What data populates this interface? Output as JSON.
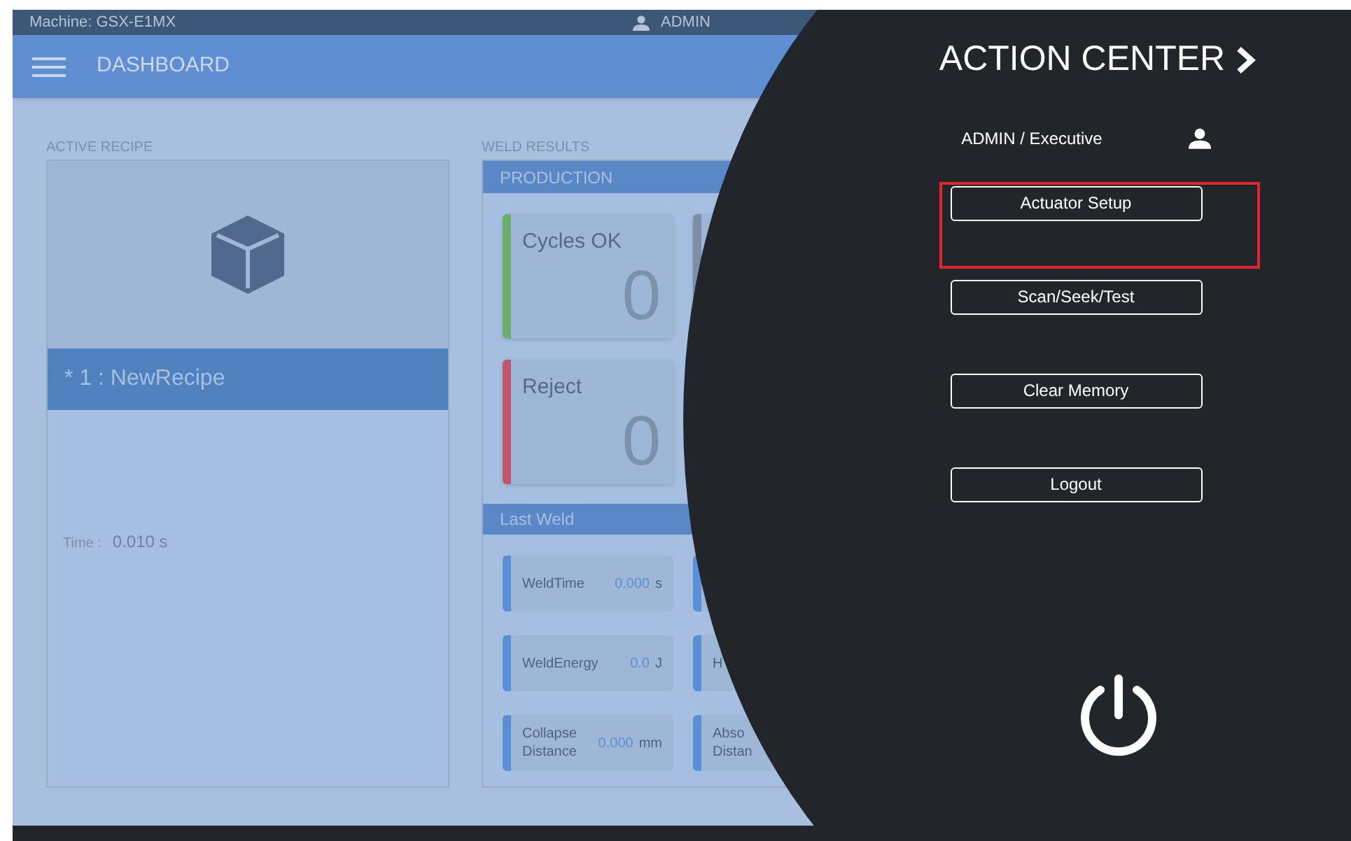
{
  "top_bar": {
    "machine": "Machine: GSX-E1MX",
    "user": "ADMIN"
  },
  "header": {
    "title": "DASHBOARD"
  },
  "active_recipe": {
    "label": "ACTIVE RECIPE",
    "recipe": "* 1 : NewRecipe",
    "selected": true,
    "time_label": "Time :",
    "time_value": "0.010 s"
  },
  "weld_results": {
    "label": "WELD RESULTS",
    "production": {
      "title": "PRODUCTION",
      "counters": [
        {
          "kind": "full",
          "label": "Cycles OK",
          "value": "0",
          "color": "#6aae6c"
        },
        {
          "kind": "cut",
          "color": "#7d8fa8"
        },
        {
          "kind": "full",
          "label": "Reject",
          "value": "0",
          "color": "#c0566e"
        }
      ]
    },
    "last_weld": {
      "title": "Last Weld",
      "items": [
        {
          "kind": "full",
          "label": "WeldTime",
          "value": "0.000",
          "unit": "s"
        },
        {
          "kind": "cut"
        },
        {
          "kind": "full",
          "label": "WeldEnergy",
          "value": "0.0",
          "unit": "J"
        },
        {
          "kind": "cut",
          "label": "H"
        },
        {
          "kind": "full",
          "label": "Collapse Distance",
          "value": "0.000",
          "unit": "mm"
        },
        {
          "kind": "cut",
          "label": "Abso Distan"
        }
      ]
    }
  },
  "action_center": {
    "title": "ACTION CENTER",
    "user": "ADMIN / Executive",
    "buttons": [
      {
        "label": "Actuator Setup",
        "highlighted": true
      },
      {
        "label": "Scan/Seek/Test",
        "highlighted": false
      },
      {
        "label": "Clear Memory",
        "highlighted": false
      },
      {
        "label": "Logout",
        "highlighted": false
      }
    ]
  }
}
